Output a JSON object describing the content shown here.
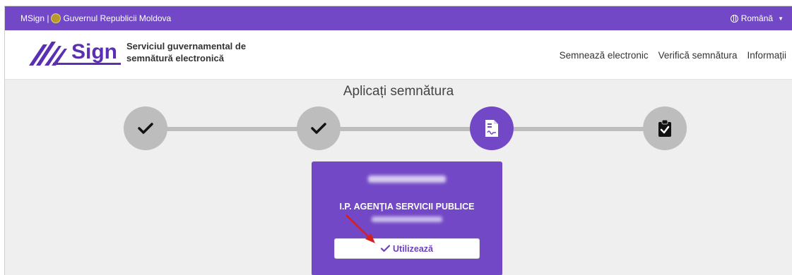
{
  "topbar": {
    "brand_text": "MSign |",
    "government": "Guvernul Republicii Moldova",
    "language": "Română"
  },
  "header": {
    "logo_text": "Sign",
    "service_line1": "Serviciul guvernamental de",
    "service_line2": "semnătură electronică",
    "nav": [
      "Semnează electronic",
      "Verifică semnătura",
      "Informații"
    ]
  },
  "page": {
    "title": "Aplicați semnătura"
  },
  "steps": [
    {
      "icon": "check-icon",
      "state": "done"
    },
    {
      "icon": "check-icon",
      "state": "done"
    },
    {
      "icon": "signature-document-icon",
      "state": "active"
    },
    {
      "icon": "clipboard-check-icon",
      "state": "pending"
    }
  ],
  "certificate": {
    "organization": "I.P. AGENŢIA SERVICII PUBLICE",
    "button_label": "Utilizează"
  },
  "colors": {
    "primary": "#7348c6",
    "step_inactive": "#bdbdbd",
    "annotation_arrow": "#d42020"
  }
}
